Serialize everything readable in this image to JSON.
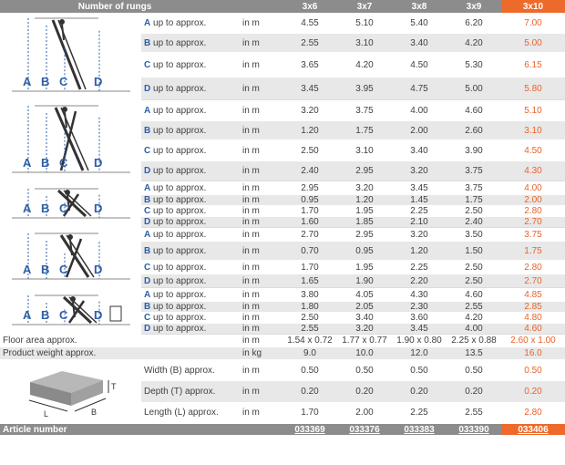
{
  "header": {
    "title": "Number of rungs",
    "columns": [
      "3x6",
      "3x7",
      "3x8",
      "3x9",
      "3x10"
    ]
  },
  "diagram_letters": [
    "A",
    "B",
    "C",
    "D"
  ],
  "groups": [
    {
      "rows": [
        {
          "letter": "A",
          "label": "up to approx.",
          "unit": "in m",
          "values": [
            "4.55",
            "5.10",
            "5.40",
            "6.20",
            "7.00"
          ]
        },
        {
          "letter": "B",
          "label": "up to approx.",
          "unit": "in m",
          "values": [
            "2.55",
            "3.10",
            "3.40",
            "4.20",
            "5.00"
          ]
        },
        {
          "letter": "C",
          "label": "up to approx.",
          "unit": "in m",
          "values": [
            "3.65",
            "4.20",
            "4.50",
            "5.30",
            "6.15"
          ]
        },
        {
          "letter": "D",
          "label": "up to approx.",
          "unit": "in m",
          "values": [
            "3.45",
            "3.95",
            "4.75",
            "5.00",
            "5.80"
          ]
        }
      ]
    },
    {
      "rows": [
        {
          "letter": "A",
          "label": "up to approx.",
          "unit": "in m",
          "values": [
            "3.20",
            "3.75",
            "4.00",
            "4.60",
            "5.10"
          ]
        },
        {
          "letter": "B",
          "label": "up to approx.",
          "unit": "in m",
          "values": [
            "1.20",
            "1.75",
            "2.00",
            "2.60",
            "3.10"
          ]
        },
        {
          "letter": "C",
          "label": "up to approx.",
          "unit": "in m",
          "values": [
            "2.50",
            "3.10",
            "3.40",
            "3.90",
            "4.50"
          ]
        },
        {
          "letter": "D",
          "label": "up to approx.",
          "unit": "in m",
          "values": [
            "2.40",
            "2.95",
            "3.20",
            "3.75",
            "4.30"
          ]
        }
      ]
    },
    {
      "rows": [
        {
          "letter": "A",
          "label": "up to approx.",
          "unit": "in m",
          "values": [
            "2.95",
            "3.20",
            "3.45",
            "3.75",
            "4.00"
          ]
        },
        {
          "letter": "B",
          "label": "up to approx.",
          "unit": "in m",
          "values": [
            "0.95",
            "1.20",
            "1.45",
            "1.75",
            "2.00"
          ]
        },
        {
          "letter": "C",
          "label": "up to approx.",
          "unit": "in m",
          "values": [
            "1.70",
            "1.95",
            "2.25",
            "2.50",
            "2.80"
          ]
        },
        {
          "letter": "D",
          "label": "up to approx.",
          "unit": "in m",
          "values": [
            "1.60",
            "1.85",
            "2.10",
            "2.40",
            "2.70"
          ]
        }
      ]
    },
    {
      "rows": [
        {
          "letter": "A",
          "label": "up to approx.",
          "unit": "in m",
          "values": [
            "2.70",
            "2.95",
            "3.20",
            "3.50",
            "3.75"
          ]
        },
        {
          "letter": "B",
          "label": "up to approx.",
          "unit": "in m",
          "values": [
            "0.70",
            "0.95",
            "1.20",
            "1.50",
            "1.75"
          ]
        },
        {
          "letter": "C",
          "label": "up to approx.",
          "unit": "in m",
          "values": [
            "1.70",
            "1.95",
            "2.25",
            "2.50",
            "2.80"
          ]
        },
        {
          "letter": "D",
          "label": "up to approx.",
          "unit": "in m",
          "values": [
            "1.65",
            "1.90",
            "2.20",
            "2.50",
            "2.70"
          ]
        }
      ]
    },
    {
      "rows": [
        {
          "letter": "A",
          "label": "up to approx.",
          "unit": "in m",
          "values": [
            "3.80",
            "4.05",
            "4.30",
            "4.60",
            "4.85"
          ]
        },
        {
          "letter": "B",
          "label": "up to approx.",
          "unit": "in m",
          "values": [
            "1.80",
            "2.05",
            "2.30",
            "2.55",
            "2.85"
          ]
        },
        {
          "letter": "C",
          "label": "up to approx.",
          "unit": "in m",
          "values": [
            "2.50",
            "3.40",
            "3.60",
            "4.20",
            "4.80"
          ]
        },
        {
          "letter": "D",
          "label": "up to approx.",
          "unit": "in m",
          "values": [
            "2.55",
            "3.20",
            "3.45",
            "4.00",
            "4.60"
          ]
        }
      ]
    }
  ],
  "floor_area": {
    "label": "Floor area approx.",
    "unit": "in m",
    "values": [
      "1.54 x 0.72",
      "1.77 x 0.77",
      "1.90 x 0.80",
      "2.25 x 0.88",
      "2.60 x 1.00"
    ]
  },
  "weight": {
    "label": "Product weight approx.",
    "unit": "in kg",
    "values": [
      "9.0",
      "10.0",
      "12.0",
      "13.5",
      "16.0"
    ]
  },
  "box": {
    "letters": {
      "t": "T",
      "l": "L",
      "b": "B"
    },
    "rows": [
      {
        "label": "Width (B) approx.",
        "unit": "in m",
        "values": [
          "0.50",
          "0.50",
          "0.50",
          "0.50",
          "0.50"
        ]
      },
      {
        "label": "Depth (T) approx.",
        "unit": "in m",
        "values": [
          "0.20",
          "0.20",
          "0.20",
          "0.20",
          "0.20"
        ]
      },
      {
        "label": "Length (L) approx.",
        "unit": "in m",
        "values": [
          "1.70",
          "2.00",
          "2.25",
          "2.55",
          "2.80"
        ]
      }
    ]
  },
  "article": {
    "label": "Article number",
    "values": [
      "033369",
      "033376",
      "033383",
      "033390",
      "033406"
    ]
  },
  "colors": {
    "accent": "#ee6a2a",
    "header": "#8c8c8c",
    "letter_blue": "#2d5fa8",
    "row_gray": "#e8e8e8"
  }
}
